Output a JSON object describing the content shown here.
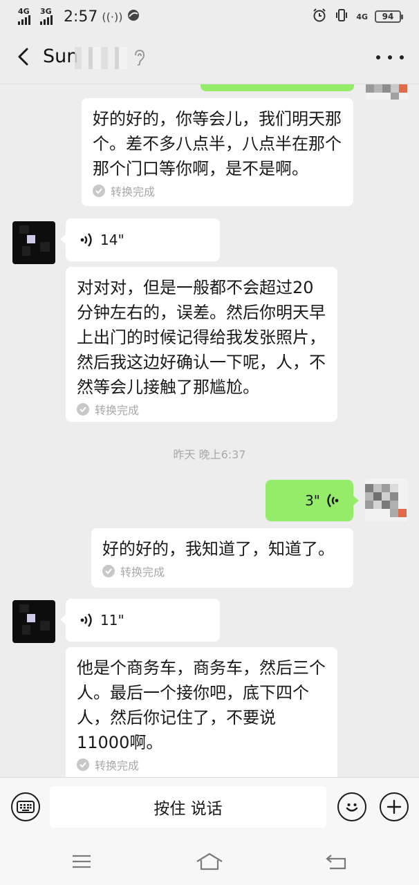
{
  "status_bar": {
    "net1": "4G",
    "net2": "3G",
    "time": "2:57",
    "battery": "94",
    "net_right": "4G"
  },
  "header": {
    "title": "Sun",
    "back_icon": "chevron-left-icon",
    "more_icon": "more-dots-icon",
    "ear_icon": "ear-icon"
  },
  "messages": [
    {
      "side": "right",
      "transcript": "好的好的，你等会儿，我们明天那个。差不多八点半，八点半在那个那个门口等你啊，是不是啊。",
      "status": "转换完成"
    },
    {
      "side": "left",
      "duration": "14\"",
      "transcript": "对对对，但是一般都不会超过20分钟左右的，误差。然后你明天早上出门的时候记得给我发张照片，然后我这边好确认一下呢，人，不然等会儿接触了那尴尬。",
      "status": "转换完成"
    },
    {
      "side": "right",
      "duration": "3\"",
      "transcript": "好的好的，我知道了，知道了。",
      "status": "转换完成"
    },
    {
      "side": "left",
      "duration": "11\"",
      "transcript": "他是个商务车，商务车，然后三个人。最后一个接你吧，底下四个人，然后你记住了，不要说11000啊。",
      "status": "转换完成"
    }
  ],
  "timestamp": "昨天 晚上6:37",
  "input_bar": {
    "hold_to_talk": "按住 说话",
    "keyboard_icon": "keyboard-icon",
    "emoji_icon": "emoji-icon",
    "plus_icon": "plus-icon"
  },
  "nav": {
    "menu_icon": "menu-icon",
    "home_icon": "home-icon",
    "back_icon": "back-arrow-icon"
  },
  "colors": {
    "background": "#ededed",
    "bubble_green": "#95ec69",
    "bubble_white": "#ffffff",
    "muted_text": "#a8a8a8"
  }
}
